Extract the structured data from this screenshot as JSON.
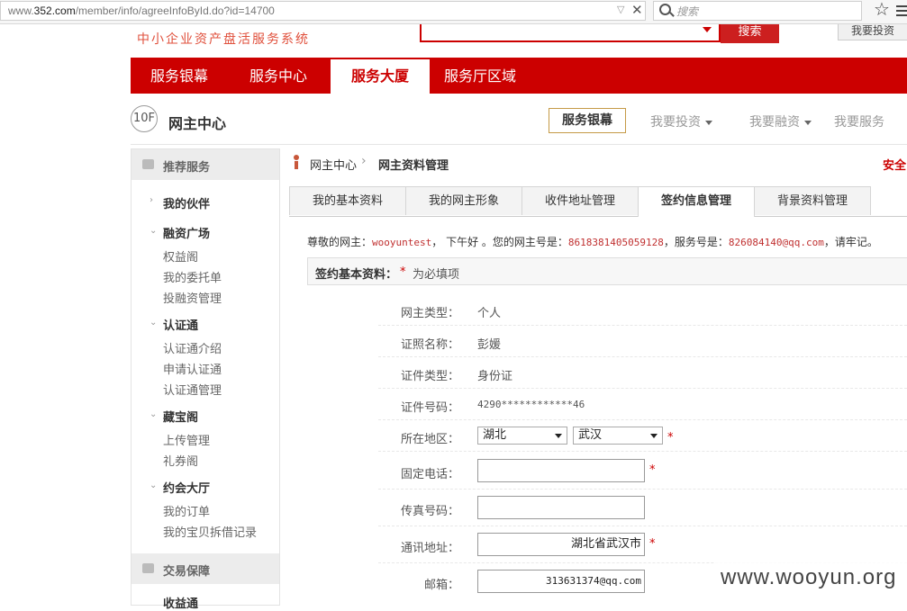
{
  "browser": {
    "url_prefix": "www.",
    "url_domain": "352.com",
    "url_path": "/member/info/agreeInfoById.do?id=14700",
    "search_placeholder": "搜索"
  },
  "site": {
    "slogan": "中小企业资产盘活服务系统",
    "search_button": "搜索",
    "invest_button": "我要投资"
  },
  "nav": {
    "items": [
      "服务银幕",
      "服务中心",
      "服务大厦",
      "服务厅区域"
    ],
    "active_index": 2
  },
  "subheader": {
    "floor": "10F",
    "title": "网主中心",
    "service_button": "服务银幕",
    "links": [
      "我要投资",
      "我要融资",
      "我要服务"
    ]
  },
  "sidebar": {
    "head1": "推荐服务",
    "groups": [
      {
        "label": "我的伙伴",
        "items": []
      },
      {
        "label": "融资广场",
        "items": [
          "权益阁",
          "我的委托单",
          "投融资管理"
        ]
      },
      {
        "label": "认证通",
        "items": [
          "认证通介绍",
          "申请认证通",
          "认证通管理"
        ]
      },
      {
        "label": "藏宝阁",
        "items": [
          "上传管理",
          "礼券阁"
        ]
      },
      {
        "label": "约会大厅",
        "items": [
          "我的订单",
          "我的宝贝拆借记录"
        ]
      }
    ],
    "head2": "交易保障",
    "cut_item": "收益通"
  },
  "breadcrumb": {
    "root": "网主中心",
    "sep": "›",
    "current": "网主资料管理",
    "right": "安全"
  },
  "tabs": [
    "我的基本资料",
    "我的网主形象",
    "收件地址管理",
    "签约信息管理",
    "背景资料管理"
  ],
  "active_tab": 3,
  "greeting": {
    "p1": "尊敬的网主：",
    "username": "wooyuntest",
    "p2": "， 下午好 。您的网主号是：",
    "owner_no": "8618381405059128",
    "p3": "，服务号是：",
    "service_no": "826084140@qq.com",
    "p4": "，请牢记。"
  },
  "section": {
    "title": "签约基本资料：",
    "star": "*",
    "note": "为必填项"
  },
  "form": {
    "owner_type_label": "网主类型：",
    "owner_type": "个人",
    "cert_name_label": "证照名称：",
    "cert_name": "彭媛",
    "cert_type_label": "证件类型：",
    "cert_type": "身份证",
    "cert_no_label": "证件号码：",
    "cert_no": "4290************46",
    "region_label": "所在地区：",
    "province": "湖北",
    "city": "武汉",
    "phone_label": "固定电话：",
    "phone": "",
    "fax_label": "传真号码：",
    "fax": "",
    "address_label": "通讯地址：",
    "address": "湖北省武汉市",
    "email_label": "邮箱：",
    "email": "313631374@qq.com",
    "required_mark": "*"
  },
  "watermark": "www.wooyun.org"
}
